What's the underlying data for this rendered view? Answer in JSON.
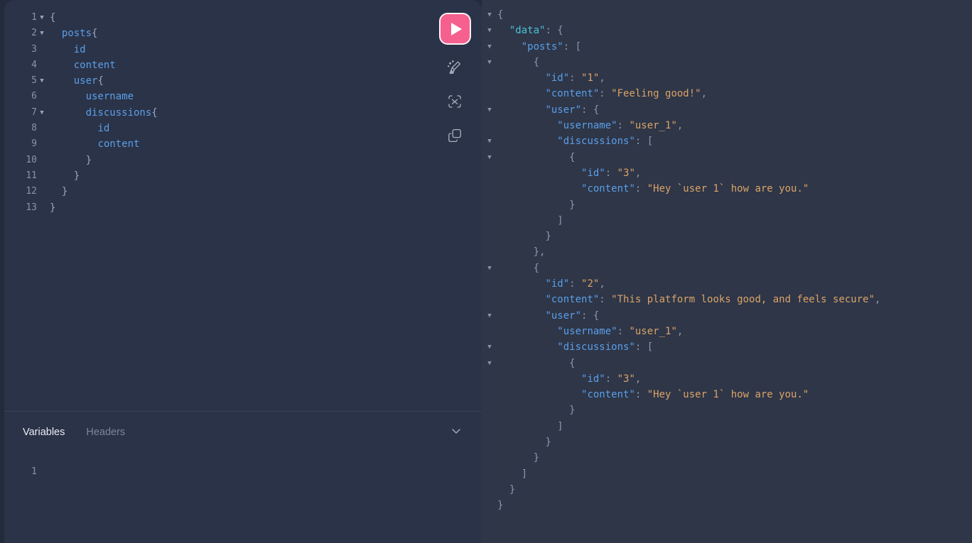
{
  "colors": {
    "app_background": "#232a3b",
    "editor_background": "#2b3348",
    "response_background": "#2e3648",
    "execute_button": "#f5608f",
    "field_name": "#5b9fe8",
    "json_key": "#5b9fe8",
    "json_key_data": "#4cc2d6",
    "json_string": "#dba368",
    "punctuation": "#8d97ab",
    "line_number": "#8a93a8"
  },
  "toolbar": {
    "execute_label": "",
    "execute_icon": "play-icon",
    "prettify_icon": "broom-sparkle-icon",
    "merge_icon": "merge-fragments-icon",
    "copy_icon": "copy-query-icon"
  },
  "query_editor": {
    "lines": [
      {
        "number": "1",
        "foldable": true,
        "indent": 0,
        "tokens": [
          {
            "t": "{",
            "c": "punc"
          }
        ]
      },
      {
        "number": "2",
        "foldable": true,
        "indent": 1,
        "tokens": [
          {
            "t": "posts",
            "c": "field"
          },
          {
            "t": "{",
            "c": "punc"
          }
        ]
      },
      {
        "number": "3",
        "foldable": false,
        "indent": 2,
        "tokens": [
          {
            "t": "id",
            "c": "field"
          }
        ]
      },
      {
        "number": "4",
        "foldable": false,
        "indent": 2,
        "tokens": [
          {
            "t": "content",
            "c": "field"
          }
        ]
      },
      {
        "number": "5",
        "foldable": true,
        "indent": 2,
        "tokens": [
          {
            "t": "user",
            "c": "field"
          },
          {
            "t": "{",
            "c": "punc"
          }
        ]
      },
      {
        "number": "6",
        "foldable": false,
        "indent": 3,
        "tokens": [
          {
            "t": "username",
            "c": "field"
          }
        ]
      },
      {
        "number": "7",
        "foldable": true,
        "indent": 3,
        "tokens": [
          {
            "t": "discussions",
            "c": "field"
          },
          {
            "t": "{",
            "c": "punc"
          }
        ]
      },
      {
        "number": "8",
        "foldable": false,
        "indent": 4,
        "tokens": [
          {
            "t": "id",
            "c": "field"
          }
        ]
      },
      {
        "number": "9",
        "foldable": false,
        "indent": 4,
        "tokens": [
          {
            "t": "content",
            "c": "field"
          }
        ]
      },
      {
        "number": "10",
        "foldable": false,
        "indent": 3,
        "tokens": [
          {
            "t": "}",
            "c": "punc"
          }
        ]
      },
      {
        "number": "11",
        "foldable": false,
        "indent": 2,
        "tokens": [
          {
            "t": "}",
            "c": "punc"
          }
        ]
      },
      {
        "number": "12",
        "foldable": false,
        "indent": 1,
        "tokens": [
          {
            "t": "}",
            "c": "punc"
          }
        ]
      },
      {
        "number": "13",
        "foldable": false,
        "indent": 0,
        "tokens": [
          {
            "t": "}",
            "c": "punc"
          }
        ]
      }
    ],
    "plain_text": "{\n  posts{\n    id\n    content\n    user{\n      username\n      discussions{\n        id\n        content\n      }\n    }\n  }\n}"
  },
  "variables_panel": {
    "tabs": [
      {
        "label": "Variables",
        "active": true
      },
      {
        "label": "Headers",
        "active": false
      }
    ],
    "collapse_icon": "chevron-down-icon",
    "lines": [
      {
        "number": "1",
        "text": ""
      }
    ],
    "value": ""
  },
  "response": {
    "lines": [
      {
        "foldable": true,
        "indent": 0,
        "tokens": [
          {
            "t": "{",
            "c": "punc"
          }
        ]
      },
      {
        "foldable": true,
        "indent": 1,
        "tokens": [
          {
            "t": "\"data\"",
            "c": "key-data"
          },
          {
            "t": ": ",
            "c": "punc"
          },
          {
            "t": "{",
            "c": "punc"
          }
        ]
      },
      {
        "foldable": true,
        "indent": 2,
        "tokens": [
          {
            "t": "\"posts\"",
            "c": "key"
          },
          {
            "t": ": ",
            "c": "punc"
          },
          {
            "t": "[",
            "c": "punc"
          }
        ]
      },
      {
        "foldable": true,
        "indent": 3,
        "tokens": [
          {
            "t": "{",
            "c": "punc"
          }
        ]
      },
      {
        "foldable": false,
        "indent": 4,
        "tokens": [
          {
            "t": "\"id\"",
            "c": "key"
          },
          {
            "t": ": ",
            "c": "punc"
          },
          {
            "t": "\"1\"",
            "c": "str"
          },
          {
            "t": ",",
            "c": "punc"
          }
        ]
      },
      {
        "foldable": false,
        "indent": 4,
        "tokens": [
          {
            "t": "\"content\"",
            "c": "key"
          },
          {
            "t": ": ",
            "c": "punc"
          },
          {
            "t": "\"Feeling good!\"",
            "c": "str"
          },
          {
            "t": ",",
            "c": "punc"
          }
        ]
      },
      {
        "foldable": true,
        "indent": 4,
        "tokens": [
          {
            "t": "\"user\"",
            "c": "key"
          },
          {
            "t": ": ",
            "c": "punc"
          },
          {
            "t": "{",
            "c": "punc"
          }
        ]
      },
      {
        "foldable": false,
        "indent": 5,
        "tokens": [
          {
            "t": "\"username\"",
            "c": "key"
          },
          {
            "t": ": ",
            "c": "punc"
          },
          {
            "t": "\"user_1\"",
            "c": "str"
          },
          {
            "t": ",",
            "c": "punc"
          }
        ]
      },
      {
        "foldable": true,
        "indent": 5,
        "tokens": [
          {
            "t": "\"discussions\"",
            "c": "key"
          },
          {
            "t": ": ",
            "c": "punc"
          },
          {
            "t": "[",
            "c": "punc"
          }
        ]
      },
      {
        "foldable": true,
        "indent": 6,
        "tokens": [
          {
            "t": "{",
            "c": "punc"
          }
        ]
      },
      {
        "foldable": false,
        "indent": 7,
        "tokens": [
          {
            "t": "\"id\"",
            "c": "key"
          },
          {
            "t": ": ",
            "c": "punc"
          },
          {
            "t": "\"3\"",
            "c": "str"
          },
          {
            "t": ",",
            "c": "punc"
          }
        ]
      },
      {
        "foldable": false,
        "indent": 7,
        "tokens": [
          {
            "t": "\"content\"",
            "c": "key"
          },
          {
            "t": ": ",
            "c": "punc"
          },
          {
            "t": "\"Hey `user 1` how are you.\"",
            "c": "str"
          }
        ]
      },
      {
        "foldable": false,
        "indent": 6,
        "tokens": [
          {
            "t": "}",
            "c": "punc"
          }
        ]
      },
      {
        "foldable": false,
        "indent": 5,
        "tokens": [
          {
            "t": "]",
            "c": "punc"
          }
        ]
      },
      {
        "foldable": false,
        "indent": 4,
        "tokens": [
          {
            "t": "}",
            "c": "punc"
          }
        ]
      },
      {
        "foldable": false,
        "indent": 3,
        "tokens": [
          {
            "t": "}",
            "c": "punc"
          },
          {
            "t": ",",
            "c": "punc"
          }
        ]
      },
      {
        "foldable": true,
        "indent": 3,
        "tokens": [
          {
            "t": "{",
            "c": "punc"
          }
        ]
      },
      {
        "foldable": false,
        "indent": 4,
        "tokens": [
          {
            "t": "\"id\"",
            "c": "key"
          },
          {
            "t": ": ",
            "c": "punc"
          },
          {
            "t": "\"2\"",
            "c": "str"
          },
          {
            "t": ",",
            "c": "punc"
          }
        ]
      },
      {
        "foldable": false,
        "indent": 4,
        "tokens": [
          {
            "t": "\"content\"",
            "c": "key"
          },
          {
            "t": ": ",
            "c": "punc"
          },
          {
            "t": "\"This platform looks good, and feels secure\"",
            "c": "str"
          },
          {
            "t": ",",
            "c": "punc"
          }
        ]
      },
      {
        "foldable": true,
        "indent": 4,
        "tokens": [
          {
            "t": "\"user\"",
            "c": "key"
          },
          {
            "t": ": ",
            "c": "punc"
          },
          {
            "t": "{",
            "c": "punc"
          }
        ]
      },
      {
        "foldable": false,
        "indent": 5,
        "tokens": [
          {
            "t": "\"username\"",
            "c": "key"
          },
          {
            "t": ": ",
            "c": "punc"
          },
          {
            "t": "\"user_1\"",
            "c": "str"
          },
          {
            "t": ",",
            "c": "punc"
          }
        ]
      },
      {
        "foldable": true,
        "indent": 5,
        "tokens": [
          {
            "t": "\"discussions\"",
            "c": "key"
          },
          {
            "t": ": ",
            "c": "punc"
          },
          {
            "t": "[",
            "c": "punc"
          }
        ]
      },
      {
        "foldable": true,
        "indent": 6,
        "tokens": [
          {
            "t": "{",
            "c": "punc"
          }
        ]
      },
      {
        "foldable": false,
        "indent": 7,
        "tokens": [
          {
            "t": "\"id\"",
            "c": "key"
          },
          {
            "t": ": ",
            "c": "punc"
          },
          {
            "t": "\"3\"",
            "c": "str"
          },
          {
            "t": ",",
            "c": "punc"
          }
        ]
      },
      {
        "foldable": false,
        "indent": 7,
        "tokens": [
          {
            "t": "\"content\"",
            "c": "key"
          },
          {
            "t": ": ",
            "c": "punc"
          },
          {
            "t": "\"Hey `user 1` how are you.\"",
            "c": "str"
          }
        ]
      },
      {
        "foldable": false,
        "indent": 6,
        "tokens": [
          {
            "t": "}",
            "c": "punc"
          }
        ]
      },
      {
        "foldable": false,
        "indent": 5,
        "tokens": [
          {
            "t": "]",
            "c": "punc"
          }
        ]
      },
      {
        "foldable": false,
        "indent": 4,
        "tokens": [
          {
            "t": "}",
            "c": "punc"
          }
        ]
      },
      {
        "foldable": false,
        "indent": 3,
        "tokens": [
          {
            "t": "}",
            "c": "punc"
          }
        ]
      },
      {
        "foldable": false,
        "indent": 2,
        "tokens": [
          {
            "t": "]",
            "c": "punc"
          }
        ]
      },
      {
        "foldable": false,
        "indent": 1,
        "tokens": [
          {
            "t": "}",
            "c": "punc"
          }
        ]
      },
      {
        "foldable": false,
        "indent": 0,
        "tokens": [
          {
            "t": "}",
            "c": "punc"
          }
        ]
      }
    ],
    "data": {
      "posts": [
        {
          "id": "1",
          "content": "Feeling good!",
          "user": {
            "username": "user_1",
            "discussions": [
              {
                "id": "3",
                "content": "Hey `user 1` how are you."
              }
            ]
          }
        },
        {
          "id": "2",
          "content": "This platform looks good, and feels secure",
          "user": {
            "username": "user_1",
            "discussions": [
              {
                "id": "3",
                "content": "Hey `user 1` how are you."
              }
            ]
          }
        }
      ]
    }
  }
}
